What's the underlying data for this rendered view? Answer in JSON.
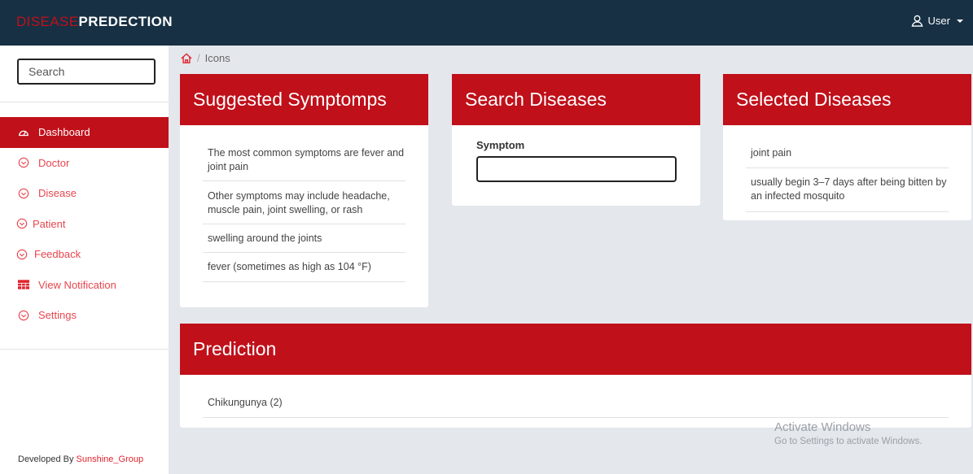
{
  "brand": {
    "part1": "DISEASE",
    "part2": "PREDECTION"
  },
  "user_menu": {
    "icon": "user-icon",
    "label": "User"
  },
  "sidebar": {
    "search_placeholder": "Search",
    "items": [
      {
        "label": "Dashboard",
        "icon": "dashboard-icon",
        "active": true
      },
      {
        "label": "Doctor",
        "icon": "chevron-down-circle-icon"
      },
      {
        "label": "Disease",
        "icon": "chevron-down-circle-icon"
      },
      {
        "label": "Patient",
        "icon": "chevron-down-circle-icon"
      },
      {
        "label": "Feedback",
        "icon": "chevron-down-circle-icon"
      },
      {
        "label": "View Notification",
        "icon": "table-icon"
      },
      {
        "label": "Settings",
        "icon": "chevron-down-circle-icon"
      }
    ],
    "footer": {
      "prefix": "Developed By ",
      "author": "Sunshine_Group"
    }
  },
  "breadcrumb": {
    "home_icon": "home-icon",
    "separator": "/",
    "current": "Icons"
  },
  "suggested": {
    "title": "Suggested Symptomps",
    "items": [
      "The most common symptoms are fever and joint pain",
      "Other symptoms may include headache, muscle pain, joint swelling, or rash",
      "swelling around the joints",
      "fever (sometimes as high as 104 °F)"
    ]
  },
  "search": {
    "title": "Search Diseases",
    "field_label": "Symptom",
    "field_value": ""
  },
  "selected": {
    "title": "Selected Diseases",
    "items": [
      "joint pain",
      "usually begin 3–7 days after being bitten by an infected mosquito"
    ]
  },
  "prediction": {
    "title": "Prediction",
    "items": [
      "Chikungunya (2)"
    ]
  },
  "watermark": {
    "line1": "Activate Windows",
    "line2": "Go to Settings to activate Windows."
  },
  "colors": {
    "topbar": "#173044",
    "accent": "#c0101a",
    "nav_text": "#e8464e",
    "background": "#e4e7ec"
  }
}
